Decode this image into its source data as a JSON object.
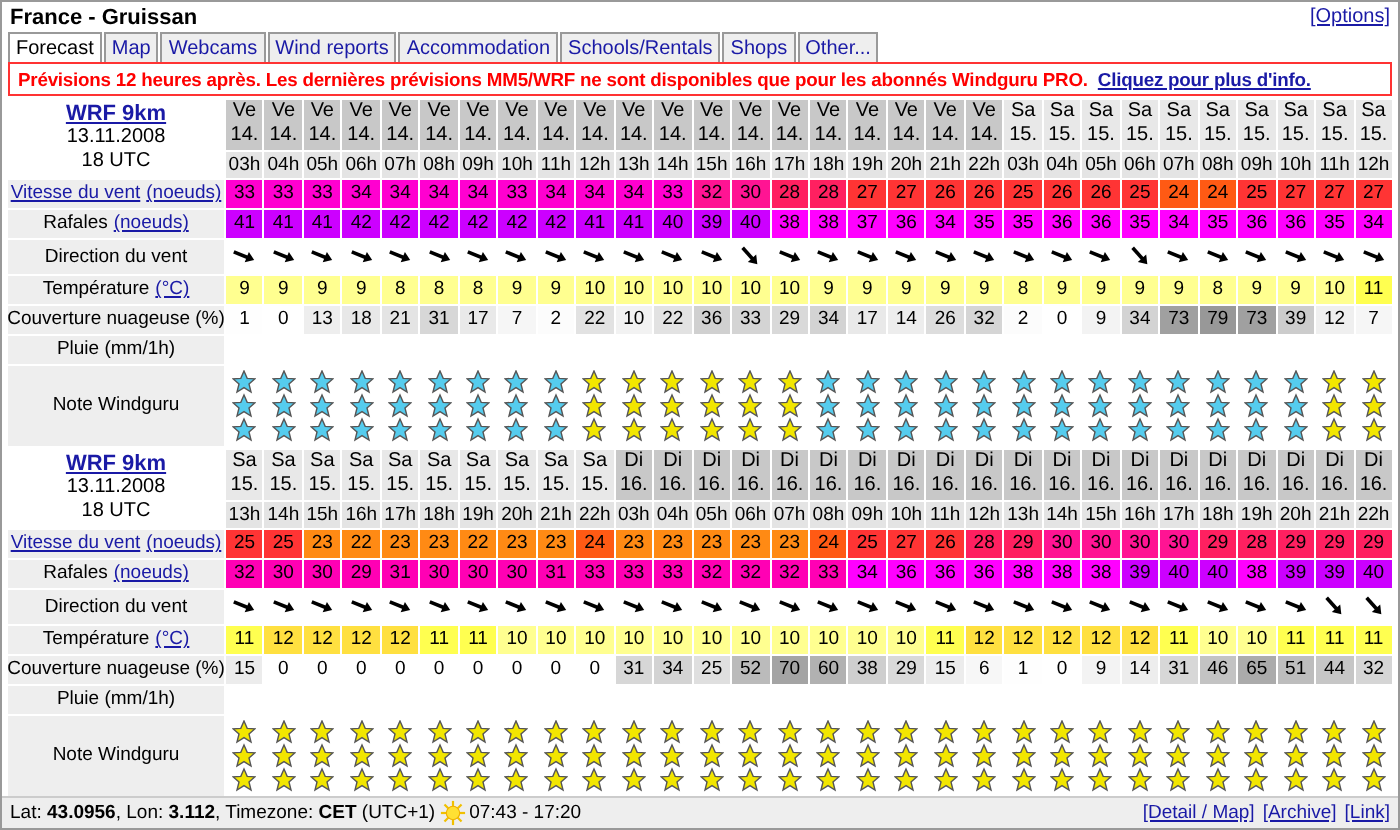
{
  "window": {
    "title": "France - Gruissan",
    "options_link": "[Options]"
  },
  "tabs": [
    {
      "label": "Forecast",
      "selected": true
    },
    {
      "label": "Map",
      "selected": false
    },
    {
      "label": "Webcams",
      "selected": false
    },
    {
      "label": "Wind reports",
      "selected": false
    },
    {
      "label": "Accommodation",
      "selected": false
    },
    {
      "label": "Schools/Rentals",
      "selected": false
    },
    {
      "label": "Shops",
      "selected": false
    },
    {
      "label": "Other...",
      "selected": false
    }
  ],
  "notice": {
    "text": "Prévisions 12 heures après. Les dernières prévisions MM5/WRF ne sont disponibles que pour les abonnés Windguru PRO.",
    "link": "Cliquez pour plus d'info."
  },
  "forecasts": [
    {
      "model": "WRF 9km",
      "date": "13.11.2008",
      "run": "18 UTC",
      "rows": [
        {
          "kind": "speed",
          "text": "Vitesse du vent",
          "text_link": true,
          "unit": "(noeuds)"
        },
        {
          "kind": "gust",
          "text": "Rafales",
          "text_link": false,
          "unit": "(noeuds)"
        },
        {
          "kind": "direction",
          "text": "Direction du vent",
          "text_link": false
        },
        {
          "kind": "temp",
          "text": "Température",
          "text_link": false,
          "unit": "(°C)"
        },
        {
          "kind": "cloud",
          "text": "Couverture nuageuse (%)",
          "text_link": false
        },
        {
          "kind": "rain",
          "text": "Pluie (mm/1h)",
          "text_link": false
        },
        {
          "kind": "rating",
          "text": "Note Windguru",
          "text_link": false
        }
      ],
      "columns": [
        {
          "day": "Ve",
          "date": "14.",
          "hour": "03h",
          "shaded": true,
          "speed": "33",
          "gust": "41",
          "direction": {
            "kind": "shallow"
          },
          "temp": "9",
          "cloud": "1",
          "rating": {
            "kind": "low"
          }
        },
        {
          "day": "Ve",
          "date": "14.",
          "hour": "04h",
          "shaded": true,
          "speed": "33",
          "gust": "41",
          "direction": {
            "kind": "shallow"
          },
          "temp": "9",
          "cloud": "0",
          "rating": {
            "kind": "low"
          }
        },
        {
          "day": "Ve",
          "date": "14.",
          "hour": "05h",
          "shaded": true,
          "speed": "33",
          "gust": "41",
          "direction": {
            "kind": "shallow"
          },
          "temp": "9",
          "cloud": "13",
          "rating": {
            "kind": "low"
          }
        },
        {
          "day": "Ve",
          "date": "14.",
          "hour": "06h",
          "shaded": true,
          "speed": "34",
          "gust": "42",
          "direction": {
            "kind": "shallow"
          },
          "temp": "9",
          "cloud": "18",
          "rating": {
            "kind": "low"
          }
        },
        {
          "day": "Ve",
          "date": "14.",
          "hour": "07h",
          "shaded": true,
          "speed": "34",
          "gust": "42",
          "direction": {
            "kind": "shallow"
          },
          "temp": "8",
          "cloud": "21",
          "rating": {
            "kind": "low"
          }
        },
        {
          "day": "Ve",
          "date": "14.",
          "hour": "08h",
          "shaded": true,
          "speed": "34",
          "gust": "42",
          "direction": {
            "kind": "shallow"
          },
          "temp": "8",
          "cloud": "31",
          "rating": {
            "kind": "low"
          }
        },
        {
          "day": "Ve",
          "date": "14.",
          "hour": "09h",
          "shaded": true,
          "speed": "34",
          "gust": "42",
          "direction": {
            "kind": "shallow"
          },
          "temp": "8",
          "cloud": "17",
          "rating": {
            "kind": "low"
          }
        },
        {
          "day": "Ve",
          "date": "14.",
          "hour": "10h",
          "shaded": true,
          "speed": "33",
          "gust": "42",
          "direction": {
            "kind": "shallow"
          },
          "temp": "9",
          "cloud": "7",
          "rating": {
            "kind": "low"
          }
        },
        {
          "day": "Ve",
          "date": "14.",
          "hour": "11h",
          "shaded": true,
          "speed": "34",
          "gust": "42",
          "direction": {
            "kind": "shallow"
          },
          "temp": "9",
          "cloud": "2",
          "rating": {
            "kind": "low"
          }
        },
        {
          "day": "Ve",
          "date": "14.",
          "hour": "12h",
          "shaded": true,
          "speed": "34",
          "gust": "41",
          "direction": {
            "kind": "shallow"
          },
          "temp": "10",
          "cloud": "22",
          "rating": {
            "kind": "high"
          }
        },
        {
          "day": "Ve",
          "date": "14.",
          "hour": "13h",
          "shaded": true,
          "speed": "34",
          "gust": "41",
          "direction": {
            "kind": "shallow"
          },
          "temp": "10",
          "cloud": "10",
          "rating": {
            "kind": "high"
          }
        },
        {
          "day": "Ve",
          "date": "14.",
          "hour": "14h",
          "shaded": true,
          "speed": "33",
          "gust": "40",
          "direction": {
            "kind": "shallow"
          },
          "temp": "10",
          "cloud": "22",
          "rating": {
            "kind": "high"
          }
        },
        {
          "day": "Ve",
          "date": "14.",
          "hour": "15h",
          "shaded": true,
          "speed": "32",
          "gust": "39",
          "direction": {
            "kind": "shallow"
          },
          "temp": "10",
          "cloud": "36",
          "rating": {
            "kind": "high"
          }
        },
        {
          "day": "Ve",
          "date": "14.",
          "hour": "16h",
          "shaded": true,
          "speed": "30",
          "gust": "40",
          "direction": {
            "kind": "steep"
          },
          "temp": "10",
          "cloud": "33",
          "rating": {
            "kind": "high"
          }
        },
        {
          "day": "Ve",
          "date": "14.",
          "hour": "17h",
          "shaded": true,
          "speed": "28",
          "gust": "38",
          "direction": {
            "kind": "shallow"
          },
          "temp": "10",
          "cloud": "29",
          "rating": {
            "kind": "high"
          }
        },
        {
          "day": "Ve",
          "date": "14.",
          "hour": "18h",
          "shaded": true,
          "speed": "28",
          "gust": "38",
          "direction": {
            "kind": "shallow"
          },
          "temp": "9",
          "cloud": "34",
          "rating": {
            "kind": "low"
          }
        },
        {
          "day": "Ve",
          "date": "14.",
          "hour": "19h",
          "shaded": true,
          "speed": "27",
          "gust": "37",
          "direction": {
            "kind": "shallow"
          },
          "temp": "9",
          "cloud": "17",
          "rating": {
            "kind": "low"
          }
        },
        {
          "day": "Ve",
          "date": "14.",
          "hour": "20h",
          "shaded": true,
          "speed": "27",
          "gust": "36",
          "direction": {
            "kind": "shallow"
          },
          "temp": "9",
          "cloud": "14",
          "rating": {
            "kind": "low"
          }
        },
        {
          "day": "Ve",
          "date": "14.",
          "hour": "21h",
          "shaded": true,
          "speed": "26",
          "gust": "34",
          "direction": {
            "kind": "shallow"
          },
          "temp": "9",
          "cloud": "26",
          "rating": {
            "kind": "low"
          }
        },
        {
          "day": "Ve",
          "date": "14.",
          "hour": "22h",
          "shaded": true,
          "speed": "26",
          "gust": "35",
          "direction": {
            "kind": "shallow"
          },
          "temp": "9",
          "cloud": "32",
          "rating": {
            "kind": "low"
          }
        },
        {
          "day": "Sa",
          "date": "15.",
          "hour": "03h",
          "shaded": false,
          "speed": "25",
          "gust": "35",
          "direction": {
            "kind": "shallow"
          },
          "temp": "8",
          "cloud": "2",
          "rating": {
            "kind": "low"
          }
        },
        {
          "day": "Sa",
          "date": "15.",
          "hour": "04h",
          "shaded": false,
          "speed": "26",
          "gust": "36",
          "direction": {
            "kind": "shallow"
          },
          "temp": "9",
          "cloud": "0",
          "rating": {
            "kind": "low"
          }
        },
        {
          "day": "Sa",
          "date": "15.",
          "hour": "05h",
          "shaded": false,
          "speed": "26",
          "gust": "36",
          "direction": {
            "kind": "shallow"
          },
          "temp": "9",
          "cloud": "9",
          "rating": {
            "kind": "low"
          }
        },
        {
          "day": "Sa",
          "date": "15.",
          "hour": "06h",
          "shaded": false,
          "speed": "25",
          "gust": "35",
          "direction": {
            "kind": "steep"
          },
          "temp": "9",
          "cloud": "34",
          "rating": {
            "kind": "low"
          }
        },
        {
          "day": "Sa",
          "date": "15.",
          "hour": "07h",
          "shaded": false,
          "speed": "24",
          "gust": "34",
          "direction": {
            "kind": "shallow"
          },
          "temp": "9",
          "cloud": "73",
          "rating": {
            "kind": "low"
          }
        },
        {
          "day": "Sa",
          "date": "15.",
          "hour": "08h",
          "shaded": false,
          "speed": "24",
          "gust": "35",
          "direction": {
            "kind": "shallow"
          },
          "temp": "8",
          "cloud": "79",
          "rating": {
            "kind": "low"
          }
        },
        {
          "day": "Sa",
          "date": "15.",
          "hour": "09h",
          "shaded": false,
          "speed": "25",
          "gust": "36",
          "direction": {
            "kind": "shallow"
          },
          "temp": "9",
          "cloud": "73",
          "rating": {
            "kind": "low"
          }
        },
        {
          "day": "Sa",
          "date": "15.",
          "hour": "10h",
          "shaded": false,
          "speed": "27",
          "gust": "36",
          "direction": {
            "kind": "shallow"
          },
          "temp": "9",
          "cloud": "39",
          "rating": {
            "kind": "low"
          }
        },
        {
          "day": "Sa",
          "date": "15.",
          "hour": "11h",
          "shaded": false,
          "speed": "27",
          "gust": "35",
          "direction": {
            "kind": "shallow"
          },
          "temp": "10",
          "cloud": "12",
          "rating": {
            "kind": "high"
          }
        },
        {
          "day": "Sa",
          "date": "15.",
          "hour": "12h",
          "shaded": false,
          "speed": "27",
          "gust": "34",
          "direction": {
            "kind": "shallow"
          },
          "temp": "11",
          "cloud": "7",
          "rating": {
            "kind": "high"
          }
        }
      ]
    },
    {
      "model": "WRF 9km",
      "date": "13.11.2008",
      "run": "18 UTC",
      "rows": [
        {
          "kind": "speed",
          "text": "Vitesse du vent",
          "text_link": true,
          "unit": "(noeuds)"
        },
        {
          "kind": "gust",
          "text": "Rafales",
          "text_link": false,
          "unit": "(noeuds)"
        },
        {
          "kind": "direction",
          "text": "Direction du vent",
          "text_link": false
        },
        {
          "kind": "temp",
          "text": "Température",
          "text_link": false,
          "unit": "(°C)"
        },
        {
          "kind": "cloud",
          "text": "Couverture nuageuse (%)",
          "text_link": false
        },
        {
          "kind": "rain",
          "text": "Pluie (mm/1h)",
          "text_link": false
        },
        {
          "kind": "rating",
          "text": "Note Windguru",
          "text_link": false
        }
      ],
      "columns": [
        {
          "day": "Sa",
          "date": "15.",
          "hour": "13h",
          "shaded": false,
          "speed": "25",
          "gust": "32",
          "direction": {
            "kind": "shallow"
          },
          "temp": "11",
          "cloud": "15",
          "rating": {
            "kind": "high"
          }
        },
        {
          "day": "Sa",
          "date": "15.",
          "hour": "14h",
          "shaded": false,
          "speed": "25",
          "gust": "30",
          "direction": {
            "kind": "shallow"
          },
          "temp": "12",
          "cloud": "0",
          "rating": {
            "kind": "high"
          }
        },
        {
          "day": "Sa",
          "date": "15.",
          "hour": "15h",
          "shaded": false,
          "speed": "23",
          "gust": "30",
          "direction": {
            "kind": "shallow"
          },
          "temp": "12",
          "cloud": "0",
          "rating": {
            "kind": "high"
          }
        },
        {
          "day": "Sa",
          "date": "15.",
          "hour": "16h",
          "shaded": false,
          "speed": "22",
          "gust": "29",
          "direction": {
            "kind": "shallow"
          },
          "temp": "12",
          "cloud": "0",
          "rating": {
            "kind": "high"
          }
        },
        {
          "day": "Sa",
          "date": "15.",
          "hour": "17h",
          "shaded": false,
          "speed": "23",
          "gust": "31",
          "direction": {
            "kind": "shallow"
          },
          "temp": "12",
          "cloud": "0",
          "rating": {
            "kind": "high"
          }
        },
        {
          "day": "Sa",
          "date": "15.",
          "hour": "18h",
          "shaded": false,
          "speed": "23",
          "gust": "30",
          "direction": {
            "kind": "shallow"
          },
          "temp": "11",
          "cloud": "0",
          "rating": {
            "kind": "high"
          }
        },
        {
          "day": "Sa",
          "date": "15.",
          "hour": "19h",
          "shaded": false,
          "speed": "22",
          "gust": "30",
          "direction": {
            "kind": "shallow"
          },
          "temp": "11",
          "cloud": "0",
          "rating": {
            "kind": "high"
          }
        },
        {
          "day": "Sa",
          "date": "15.",
          "hour": "20h",
          "shaded": false,
          "speed": "23",
          "gust": "30",
          "direction": {
            "kind": "shallow"
          },
          "temp": "10",
          "cloud": "0",
          "rating": {
            "kind": "high"
          }
        },
        {
          "day": "Sa",
          "date": "15.",
          "hour": "21h",
          "shaded": false,
          "speed": "23",
          "gust": "31",
          "direction": {
            "kind": "shallow"
          },
          "temp": "10",
          "cloud": "0",
          "rating": {
            "kind": "high"
          }
        },
        {
          "day": "Sa",
          "date": "15.",
          "hour": "22h",
          "shaded": false,
          "speed": "24",
          "gust": "33",
          "direction": {
            "kind": "shallow"
          },
          "temp": "10",
          "cloud": "0",
          "rating": {
            "kind": "high"
          }
        },
        {
          "day": "Di",
          "date": "16.",
          "hour": "03h",
          "shaded": true,
          "speed": "23",
          "gust": "33",
          "direction": {
            "kind": "shallow"
          },
          "temp": "10",
          "cloud": "31",
          "rating": {
            "kind": "high"
          }
        },
        {
          "day": "Di",
          "date": "16.",
          "hour": "04h",
          "shaded": true,
          "speed": "23",
          "gust": "33",
          "direction": {
            "kind": "shallow"
          },
          "temp": "10",
          "cloud": "34",
          "rating": {
            "kind": "high"
          }
        },
        {
          "day": "Di",
          "date": "16.",
          "hour": "05h",
          "shaded": true,
          "speed": "23",
          "gust": "32",
          "direction": {
            "kind": "shallow"
          },
          "temp": "10",
          "cloud": "25",
          "rating": {
            "kind": "high"
          }
        },
        {
          "day": "Di",
          "date": "16.",
          "hour": "06h",
          "shaded": true,
          "speed": "23",
          "gust": "32",
          "direction": {
            "kind": "shallow"
          },
          "temp": "10",
          "cloud": "52",
          "rating": {
            "kind": "high"
          }
        },
        {
          "day": "Di",
          "date": "16.",
          "hour": "07h",
          "shaded": true,
          "speed": "23",
          "gust": "32",
          "direction": {
            "kind": "shallow"
          },
          "temp": "10",
          "cloud": "70",
          "rating": {
            "kind": "high"
          }
        },
        {
          "day": "Di",
          "date": "16.",
          "hour": "08h",
          "shaded": true,
          "speed": "24",
          "gust": "33",
          "direction": {
            "kind": "shallow"
          },
          "temp": "10",
          "cloud": "60",
          "rating": {
            "kind": "high"
          }
        },
        {
          "day": "Di",
          "date": "16.",
          "hour": "09h",
          "shaded": true,
          "speed": "25",
          "gust": "34",
          "direction": {
            "kind": "shallow"
          },
          "temp": "10",
          "cloud": "38",
          "rating": {
            "kind": "high"
          }
        },
        {
          "day": "Di",
          "date": "16.",
          "hour": "10h",
          "shaded": true,
          "speed": "27",
          "gust": "36",
          "direction": {
            "kind": "shallow"
          },
          "temp": "10",
          "cloud": "29",
          "rating": {
            "kind": "high"
          }
        },
        {
          "day": "Di",
          "date": "16.",
          "hour": "11h",
          "shaded": true,
          "speed": "26",
          "gust": "36",
          "direction": {
            "kind": "shallow"
          },
          "temp": "11",
          "cloud": "15",
          "rating": {
            "kind": "high"
          }
        },
        {
          "day": "Di",
          "date": "16.",
          "hour": "12h",
          "shaded": true,
          "speed": "28",
          "gust": "36",
          "direction": {
            "kind": "shallow"
          },
          "temp": "12",
          "cloud": "6",
          "rating": {
            "kind": "high"
          }
        },
        {
          "day": "Di",
          "date": "16.",
          "hour": "13h",
          "shaded": true,
          "speed": "29",
          "gust": "38",
          "direction": {
            "kind": "shallow"
          },
          "temp": "12",
          "cloud": "1",
          "rating": {
            "kind": "high"
          }
        },
        {
          "day": "Di",
          "date": "16.",
          "hour": "14h",
          "shaded": true,
          "speed": "30",
          "gust": "38",
          "direction": {
            "kind": "shallow"
          },
          "temp": "12",
          "cloud": "0",
          "rating": {
            "kind": "high"
          }
        },
        {
          "day": "Di",
          "date": "16.",
          "hour": "15h",
          "shaded": true,
          "speed": "30",
          "gust": "38",
          "direction": {
            "kind": "shallow"
          },
          "temp": "12",
          "cloud": "9",
          "rating": {
            "kind": "high"
          }
        },
        {
          "day": "Di",
          "date": "16.",
          "hour": "16h",
          "shaded": true,
          "speed": "30",
          "gust": "39",
          "direction": {
            "kind": "shallow"
          },
          "temp": "12",
          "cloud": "14",
          "rating": {
            "kind": "high"
          }
        },
        {
          "day": "Di",
          "date": "16.",
          "hour": "17h",
          "shaded": true,
          "speed": "30",
          "gust": "40",
          "direction": {
            "kind": "shallow"
          },
          "temp": "11",
          "cloud": "31",
          "rating": {
            "kind": "high"
          }
        },
        {
          "day": "Di",
          "date": "16.",
          "hour": "18h",
          "shaded": true,
          "speed": "29",
          "gust": "40",
          "direction": {
            "kind": "shallow"
          },
          "temp": "10",
          "cloud": "46",
          "rating": {
            "kind": "high"
          }
        },
        {
          "day": "Di",
          "date": "16.",
          "hour": "19h",
          "shaded": true,
          "speed": "28",
          "gust": "38",
          "direction": {
            "kind": "shallow"
          },
          "temp": "10",
          "cloud": "65",
          "rating": {
            "kind": "high"
          }
        },
        {
          "day": "Di",
          "date": "16.",
          "hour": "20h",
          "shaded": true,
          "speed": "29",
          "gust": "39",
          "direction": {
            "kind": "shallow"
          },
          "temp": "11",
          "cloud": "51",
          "rating": {
            "kind": "high"
          }
        },
        {
          "day": "Di",
          "date": "16.",
          "hour": "21h",
          "shaded": true,
          "speed": "29",
          "gust": "39",
          "direction": {
            "kind": "steep"
          },
          "temp": "11",
          "cloud": "44",
          "rating": {
            "kind": "high"
          }
        },
        {
          "day": "Di",
          "date": "16.",
          "hour": "22h",
          "shaded": true,
          "speed": "29",
          "gust": "40",
          "direction": {
            "kind": "steep"
          },
          "temp": "11",
          "cloud": "32",
          "rating": {
            "kind": "high"
          }
        }
      ]
    }
  ],
  "footer": {
    "location": "Lat: **43.0956**, Lon: **3.112**, Timezone: **CET** (UTC+1)",
    "sun_times": "07:43 - 17:20",
    "links": [
      "[Detail / Map]",
      "[Archive]",
      "[Link]"
    ]
  }
}
